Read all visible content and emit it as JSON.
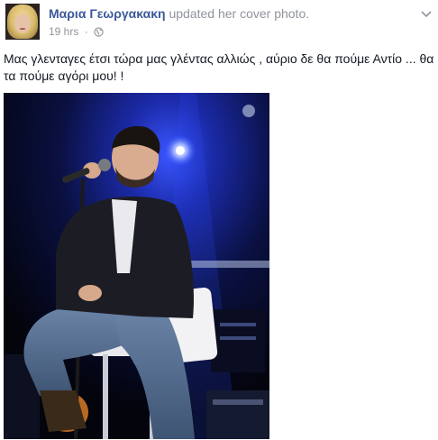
{
  "post": {
    "author_name": "Μαρια Γεωργακακη",
    "action_text": "updated her cover photo.",
    "timestamp": "19 hrs",
    "separator": "·",
    "audience_icon": "globe-icon",
    "menu_icon": "chevron-down-icon",
    "message": "Μας γλενταγες έτσι τώρα μας γλέντας αλλιώς , αύριο δε θα πούμε Αντίο ... θα τα πούμε αγόρι μου! !",
    "photo_icon": "concert-photo"
  },
  "colors": {
    "link_blue": "#3b5998",
    "meta_gray": "#90949c",
    "text": "#141823",
    "stage_light": "#2d4cff"
  }
}
